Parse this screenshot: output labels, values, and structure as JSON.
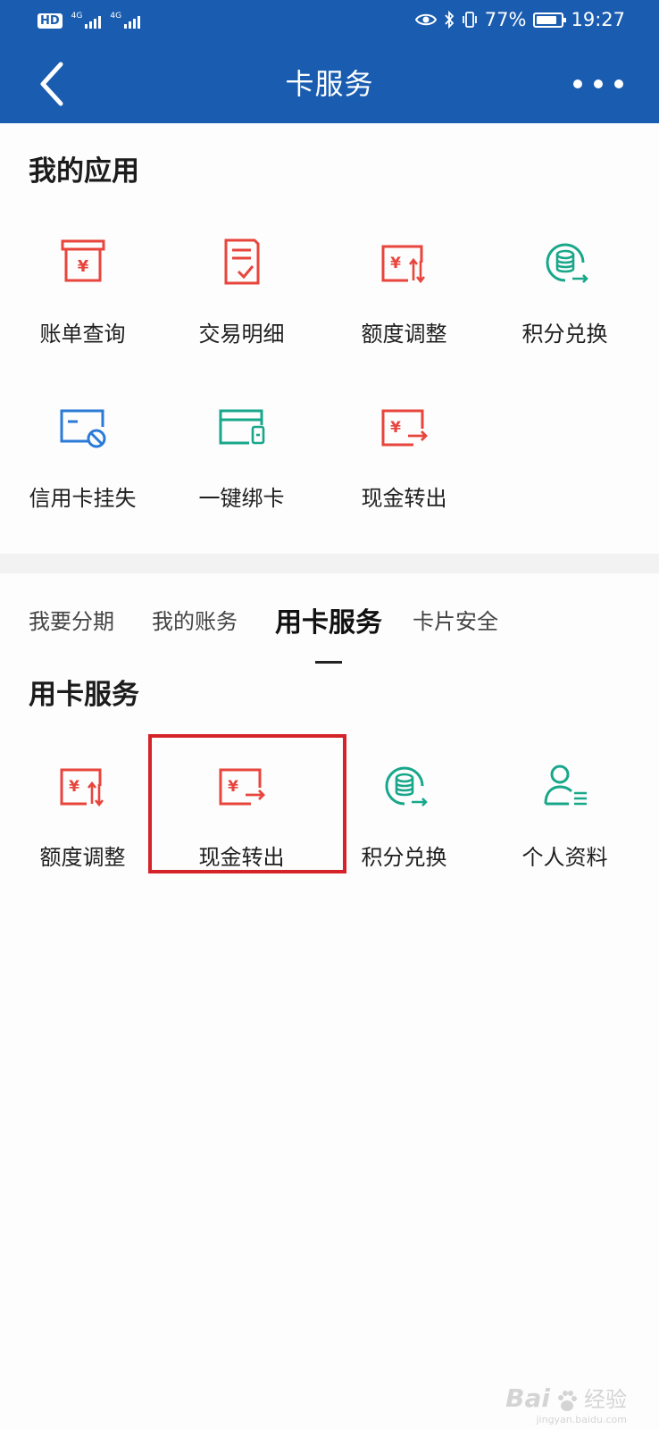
{
  "status_bar": {
    "left_badge": "HD",
    "network_1": "4G",
    "network_2": "4G",
    "battery": "77%",
    "time": "19:27"
  },
  "header": {
    "title": "卡服务",
    "back_icon": "chevron-left-icon",
    "more_icon": "more-dots-icon"
  },
  "my_apps": {
    "title": "我的应用",
    "items": [
      {
        "label": "账单查询",
        "icon": "bill-icon"
      },
      {
        "label": "交易明细",
        "icon": "transaction-detail-icon"
      },
      {
        "label": "额度调整",
        "icon": "limit-adjust-icon"
      },
      {
        "label": "积分兑换",
        "icon": "points-exchange-icon"
      },
      {
        "label": "信用卡挂失",
        "icon": "card-report-loss-icon"
      },
      {
        "label": "一键绑卡",
        "icon": "bind-card-icon"
      },
      {
        "label": "现金转出",
        "icon": "cash-transfer-icon"
      }
    ]
  },
  "tabs": {
    "items": [
      "我要分期",
      "我的账务",
      "用卡服务",
      "卡片安全"
    ],
    "active_index": 2
  },
  "card_service": {
    "title": "用卡服务",
    "items": [
      {
        "label": "额度调整",
        "icon": "limit-adjust-icon"
      },
      {
        "label": "现金转出",
        "icon": "cash-transfer-icon"
      },
      {
        "label": "积分兑换",
        "icon": "points-exchange-icon"
      },
      {
        "label": "个人资料",
        "icon": "personal-info-icon"
      }
    ]
  },
  "watermark": {
    "brand": "Bai",
    "brand_suffix": "经验",
    "url": "jingyan.baidu.com"
  },
  "colors": {
    "header_bg": "#1a5db0",
    "icon_red": "#e8453c",
    "icon_green": "#18a78a",
    "icon_blue": "#2a7ad8",
    "highlight_red": "#d42329"
  }
}
